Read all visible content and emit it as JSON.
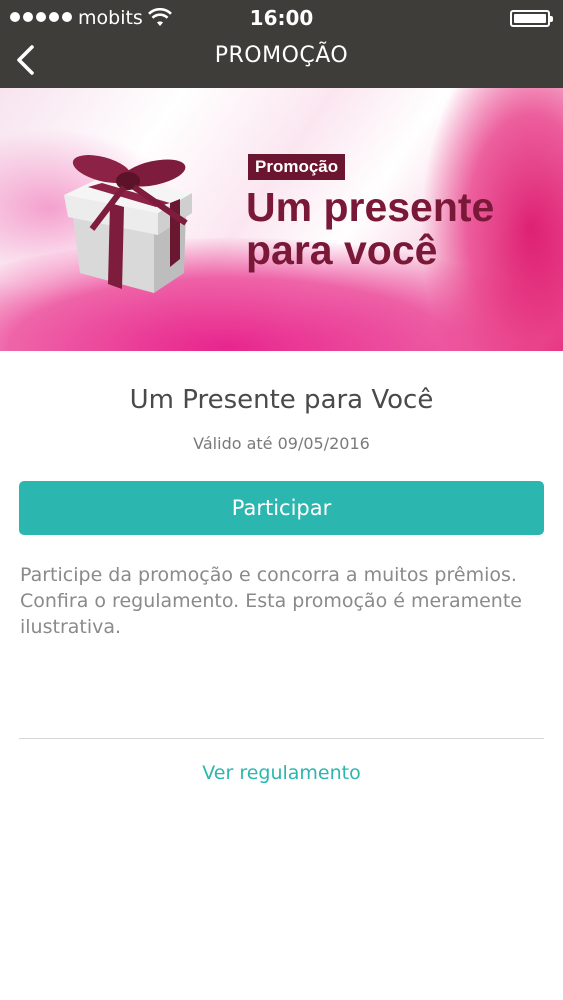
{
  "status_bar": {
    "carrier": "mobits",
    "time": "16:00",
    "signal_bars": 5,
    "battery_level": 1.0
  },
  "nav": {
    "title": "PROMOÇÃO",
    "back_icon": "chevron-left-icon"
  },
  "banner": {
    "badge": "Promoção",
    "headline_line1": "Um presente",
    "headline_line2": "para você",
    "image_icon": "gift-box-icon",
    "accent_color": "#6b1530"
  },
  "promotion": {
    "title": "Um Presente para Você",
    "valid_until": "Válido até 09/05/2016",
    "participate_label": "Participar",
    "description": "Participe da promoção e concorra a muitos prêmios. Confira o regulamento. Esta promoção é meramente ilustrativa.",
    "regulation_link": "Ver regulamento"
  },
  "colors": {
    "topbar": "#3e3d39",
    "primary": "#2cb6b0"
  }
}
